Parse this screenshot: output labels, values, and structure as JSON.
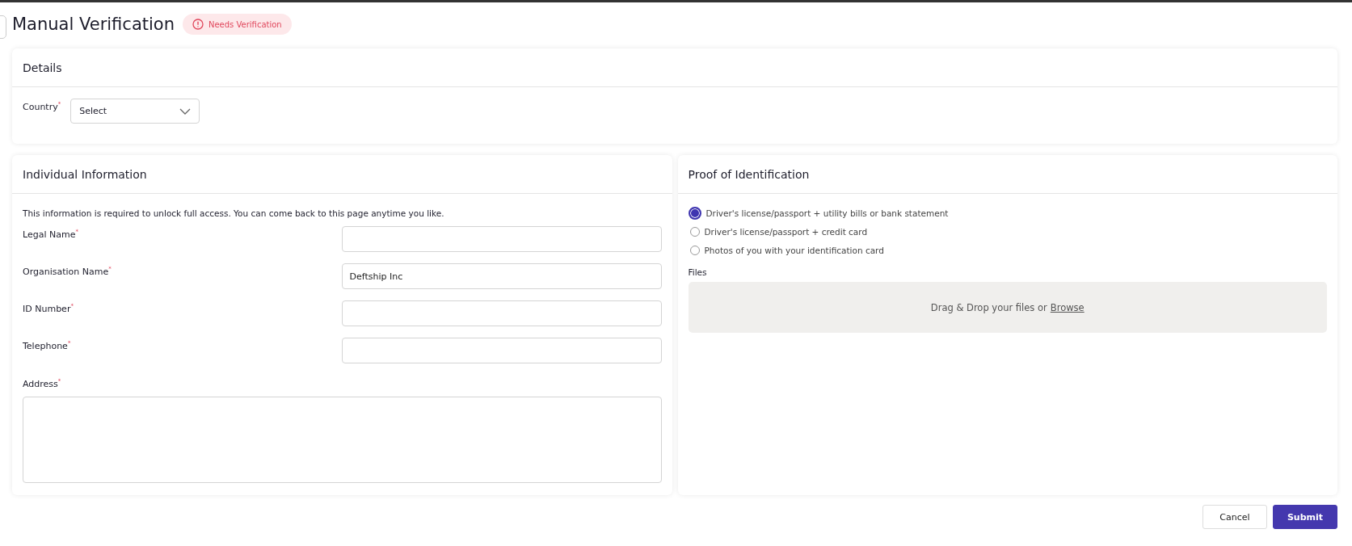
{
  "header": {
    "title": "Manual Verification",
    "status_badge": "Needs Verification"
  },
  "details": {
    "title": "Details",
    "country": {
      "label": "Country$^{*}$",
      "value": "Select"
    }
  },
  "individual": {
    "title": "Individual Information",
    "intro": "This information is required to unlock full access. You can come back to this page anytime you like.",
    "fields": [
      {
        "label": "Legal Name$^{*}$"
      },
      {
        "label": "Organisation Name$^{*}$",
        "value": "Deftship Inc"
      },
      {
        "label": "ID Number$^{*}$"
      },
      {
        "label": "Telephone$^{*}$"
      }
    ],
    "address": {
      "label": "Address$^{*}$"
    }
  },
  "proof": {
    "title": "Proof of Identification",
    "options": [
      {
        "label": "Driver's license/passport + utility bills or bank statement",
        "selected": true
      },
      {
        "label": "Driver's license/passport + credit card",
        "selected": false
      },
      {
        "label": "Photos of you with your identification card",
        "selected": false
      }
    ],
    "files_label": "Files",
    "drop_text": "Drag & Drop your files or",
    "browse_link": "Browse"
  },
  "buttons": {
    "cancel": "Cancel",
    "submit": "Submit"
  }
}
